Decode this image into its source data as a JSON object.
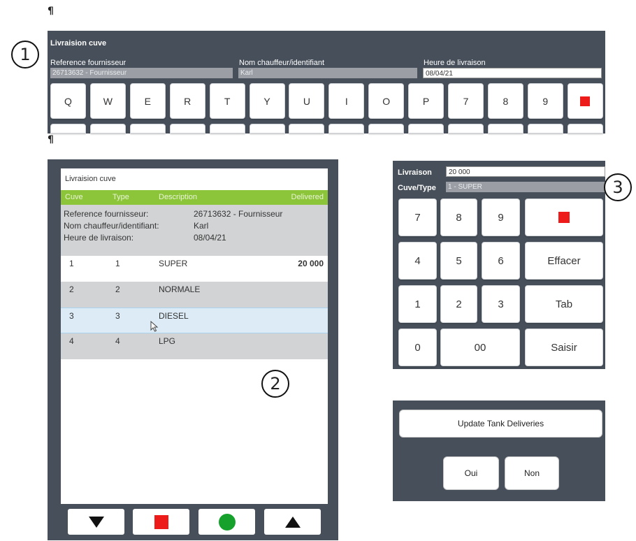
{
  "markers": {
    "pilcrow": "¶",
    "n1": "1",
    "n2": "2",
    "n3": "3"
  },
  "top_form": {
    "title": "Livraision cuve",
    "ref_label": "Reference fournisseur",
    "ref_value": "26713632 - Fournisseur",
    "driver_label": "Nom chauffeur/identifiant",
    "driver_value": "Karl",
    "time_label": "Heure de livraison",
    "time_value": "08/04/21",
    "keys": [
      "Q",
      "W",
      "E",
      "R",
      "T",
      "Y",
      "U",
      "I",
      "O",
      "P",
      "7",
      "8",
      "9"
    ]
  },
  "list_panel": {
    "title": "Livraision cuve",
    "columns": {
      "cuve": "Cuve",
      "type": "Type",
      "description": "Description",
      "delivered": "Delivered"
    },
    "info": {
      "ref_label": "Reference fournisseur:",
      "ref_value": "26713632 - Fournisseur",
      "driver_label": "Nom chauffeur/identifiant:",
      "driver_value": "Karl",
      "time_label": "Heure de livraison:",
      "time_value": "08/04/21"
    },
    "rows": [
      {
        "cuve": "1",
        "type": "1",
        "description": "SUPER",
        "delivered": "20 000"
      },
      {
        "cuve": "2",
        "type": "2",
        "description": "NORMALE",
        "delivered": ""
      },
      {
        "cuve": "3",
        "type": "3",
        "description": "DIESEL",
        "delivered": ""
      },
      {
        "cuve": "4",
        "type": "4",
        "description": "LPG",
        "delivered": ""
      }
    ],
    "selected_row": 3
  },
  "numpad": {
    "livraison_label": "Livraison",
    "livraison_value": "20 000",
    "cuve_label": "Cuve/Type",
    "cuve_value": "1 - SUPER",
    "keys": {
      "k7": "7",
      "k8": "8",
      "k9": "9",
      "k4": "4",
      "k5": "5",
      "k6": "6",
      "k1": "1",
      "k2": "2",
      "k3": "3",
      "k0": "0",
      "k00": "00",
      "clear": "Effacer",
      "tab": "Tab",
      "enter": "Saisir"
    }
  },
  "dialog": {
    "message": "Update Tank Deliveries",
    "yes": "Oui",
    "no": "Non"
  },
  "colors": {
    "panel": "#474f5a",
    "accent_green": "#8cc43a",
    "stop_red": "#ee1b1b",
    "go_green": "#16a02c"
  }
}
